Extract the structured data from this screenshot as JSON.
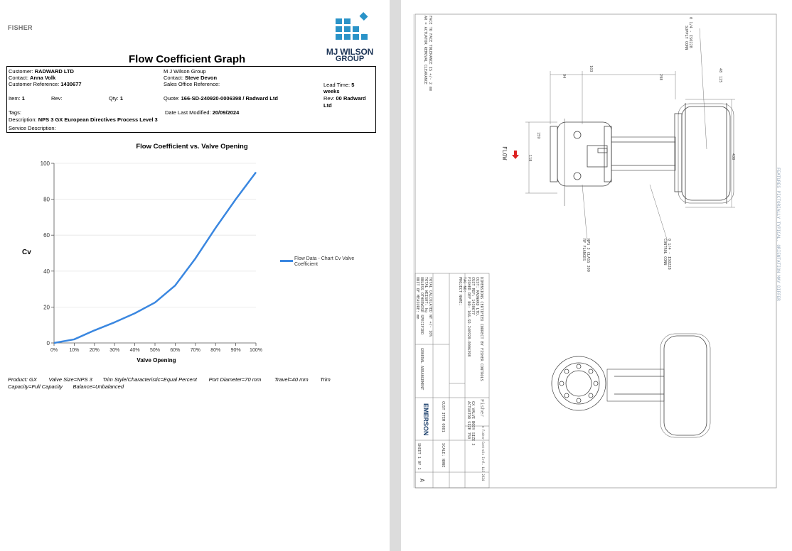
{
  "left_page": {
    "brand": "FISHER",
    "title": "Flow Coefficient Graph",
    "logo": {
      "line1": "MJ WILSON",
      "line2": "GROUP",
      "color": "#2a93c8"
    },
    "info": {
      "customer_label": "Customer:",
      "customer": "RADWARD LTD",
      "contact_label": "Contact:",
      "contact": "Anna Volk",
      "custref_label": "Customer Reference:",
      "custref": "1430677",
      "item_label": "Item:",
      "item": "1",
      "rev_label": "Rev:",
      "qty_label": "Qty:",
      "qty": "1",
      "tags_label": "Tags:",
      "desc_label": "Description:",
      "desc": "NPS 3 GX European Directives Process Level 3",
      "service_label": "Service Description:",
      "company": "M J Wilson Group",
      "contact2_label": "Contact:",
      "contact2": "Steve Devon",
      "sales_label": "Sales Office Reference:",
      "quote_label": "Quote:",
      "quote": "166-SD-240920-0006398 / Radward Ltd",
      "date_label": "Date Last Modified:",
      "date": "20/09/2024",
      "lead_label": "Lead Time:",
      "lead1": "5",
      "lead2": "weeks",
      "rev2_label": "Rev:",
      "rev2a": "00 Radward",
      "rev2b": "Ltd"
    },
    "footer": {
      "product": "Product: GX",
      "valve_size": "Valve Size=NPS 3",
      "trim_style": "Trim Style/Characteristic=Equal Percent",
      "port": "Port Diameter=70 mm",
      "travel": "Travel=40 mm",
      "trim": "Trim",
      "capacity": "Capacity=Full Capacity",
      "balance": "Balance=Unbalanced"
    }
  },
  "chart_data": {
    "type": "line",
    "title": "Flow Coefficient vs. Valve Opening",
    "xlabel": "Valve Opening",
    "ylabel": "Cv",
    "x": [
      0,
      10,
      20,
      30,
      40,
      50,
      60,
      70,
      80,
      90,
      100
    ],
    "x_tick_labels": [
      "0%",
      "10%",
      "20%",
      "30%",
      "40%",
      "50%",
      "60%",
      "70%",
      "80%",
      "90%",
      "100%"
    ],
    "y_ticks": [
      0,
      20,
      40,
      60,
      80,
      100
    ],
    "ylim": [
      0,
      100
    ],
    "series": [
      {
        "name": "Flow Data - Chart Cv Valve Coefficient",
        "color": "#3a87e0",
        "values": [
          0,
          2,
          7,
          11.5,
          16.5,
          22.5,
          32,
          47,
          64,
          80,
          95
        ]
      }
    ],
    "legend_position": "right",
    "grid": "horizontal"
  },
  "right_page": {
    "dims": [
      "103",
      "94",
      "298",
      "48",
      "125",
      "159",
      "118",
      "430"
    ],
    "supply_conn": "0 1/4 - ISO228",
    "supply_conn2": "SUPPLY CONN",
    "control_conn": "0 1/4 - ISO228",
    "control_conn2": "CONTROL CONN",
    "flange1": "NPS 3 CLASS 300",
    "flange2": "RF FLANGES",
    "flow": "FLOW",
    "note1": "FACE TO FACE TOLERANCE IS +/- 2 mm",
    "note2": "AR = ACTUATOR REMOVAL CLEARANCE",
    "side_note": "FEATURES PICTORIALLY TYPICAL. ORIENTATION MAY DIFFER",
    "tb_cert": "DIMENSIONS CERTIFIED CORRECT BY FISHER CONTROLS",
    "tb_cust": "CUST: RADWARD LTD.",
    "tb_custref": "CUST REF: 1430677",
    "tb_fisher": "FISHER REF NO: 166-SD-240920-0006398",
    "tb_tag": "TAG NO:",
    "tb_project": "PROJECT NAME:",
    "tb_w1": "TOTAL CALCULATED WT +/- 10%",
    "tb_w2": "TOTAL WEIGHT: kg",
    "tb_w3": "UNLESS OTHERWISE SPECIFIED",
    "tb_w4": "UNIT OF MEASURE: mm",
    "tb_ga": "GENERAL ARRANGEMENT",
    "tb_fisher_logo": "Fisher",
    "tb_copy": "© Fisher Controls Intl. LLC 2024",
    "tb_body": "GX VALVE BODY SIZE 3",
    "tb_act": "ACTUATOR SIZE 750",
    "tb_item": "CUST ITEM 0001",
    "tb_emerson": "EMERSON",
    "tb_scale": "SCALE: NONE",
    "tb_sheet": "SHEET 1 OF 1",
    "tb_rev": "A"
  }
}
